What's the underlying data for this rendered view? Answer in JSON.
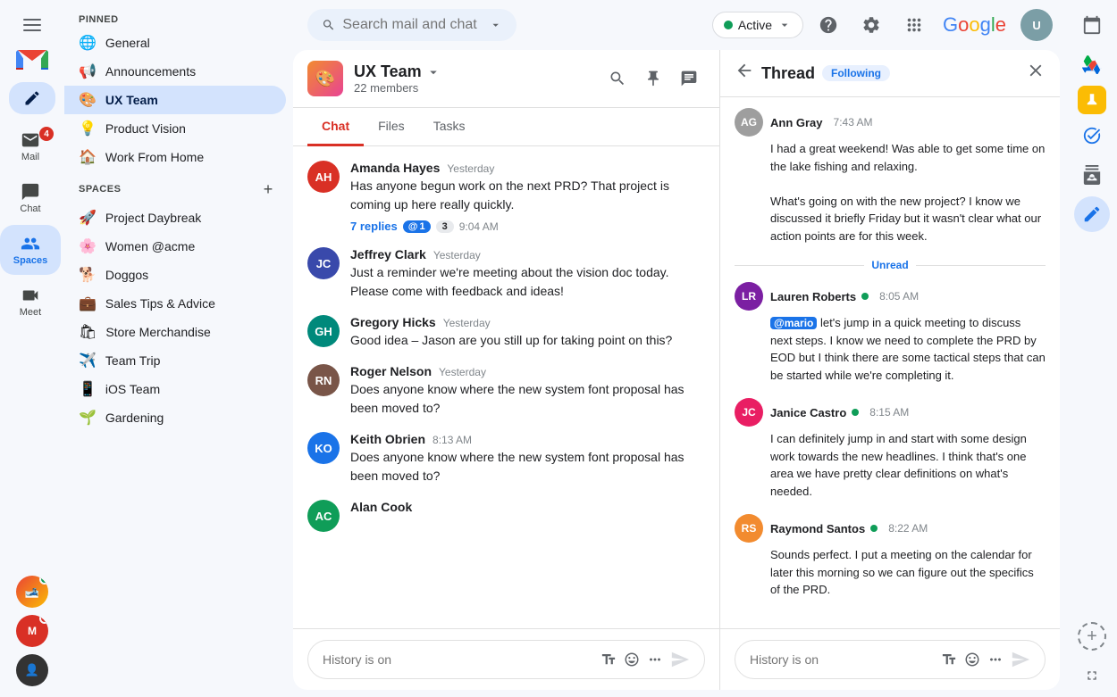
{
  "app": {
    "title": "Gmail",
    "search_placeholder": "Search mail and chat"
  },
  "status": {
    "label": "Active",
    "dropdown_icon": "▾"
  },
  "nav": {
    "compose_icon": "✏",
    "mail_label": "Mail",
    "mail_badge": "4",
    "chat_label": "Chat",
    "spaces_label": "Spaces",
    "meet_label": "Meet"
  },
  "sidebar": {
    "pinned_label": "PINNED",
    "spaces_label": "SPACES",
    "pinned_items": [
      {
        "icon": "🌐",
        "label": "General"
      },
      {
        "icon": "📢",
        "label": "Announcements"
      },
      {
        "icon": "🎨",
        "label": "UX Team",
        "active": true
      },
      {
        "icon": "💡",
        "label": "Product Vision"
      },
      {
        "icon": "🏠",
        "label": "Work From Home"
      }
    ],
    "spaces_items": [
      {
        "icon": "🚀",
        "label": "Project Daybreak"
      },
      {
        "icon": "🌸",
        "label": "Women @acme"
      },
      {
        "icon": "🐕",
        "label": "Doggos"
      },
      {
        "icon": "💼",
        "label": "Sales Tips & Advice"
      },
      {
        "icon": "🛍",
        "label": "Store Merchandise"
      },
      {
        "icon": "✈️",
        "label": "Team Trip"
      },
      {
        "icon": "📱",
        "label": "iOS Team"
      },
      {
        "icon": "🌱",
        "label": "Gardening"
      }
    ]
  },
  "channel": {
    "name": "UX Team",
    "members": "22 members",
    "tabs": [
      "Chat",
      "Files",
      "Tasks"
    ],
    "active_tab": "Chat"
  },
  "messages": [
    {
      "author": "Amanda Hayes",
      "time": "Yesterday",
      "text": "Has anyone begun work on the next PRD? That project is coming up here really quickly.",
      "replies": "7 replies",
      "badge1": "1",
      "badge2": "3",
      "reply_time": "9:04 AM",
      "avatar_color": "av-red",
      "initials": "AH"
    },
    {
      "author": "Jeffrey Clark",
      "time": "Yesterday",
      "text": "Just a reminder we're meeting about the vision doc today. Please come with feedback and ideas!",
      "avatar_color": "av-indigo",
      "initials": "JC"
    },
    {
      "author": "Gregory Hicks",
      "time": "Yesterday",
      "text": "Good idea – Jason are you still up for taking point on this?",
      "avatar_color": "av-teal",
      "initials": "GH"
    },
    {
      "author": "Roger Nelson",
      "time": "Yesterday",
      "text": "Does anyone know where the new system font proposal has been moved to?",
      "avatar_color": "av-brown",
      "initials": "RN"
    },
    {
      "author": "Keith Obrien",
      "time": "8:13 AM",
      "text": "Does anyone know where the new system font proposal has been moved to?",
      "avatar_color": "av-blue",
      "initials": "KO"
    },
    {
      "author": "Alan Cook",
      "time": "",
      "text": "",
      "avatar_color": "av-green",
      "initials": "AC"
    }
  ],
  "chat_input": {
    "placeholder": "History is on"
  },
  "thread": {
    "title": "Thread",
    "following": "Following",
    "messages": [
      {
        "author": "Ann Gray",
        "time": "7:43 AM",
        "text": "I had a great weekend! Was able to get some time on the lake fishing and relaxing.\n\nWhat's going on with the new project? I know we discussed it briefly Friday but it wasn't clear what our action points are for this week.",
        "avatar_color": "av-gray",
        "initials": "AG",
        "online": false
      },
      {
        "author": "Lauren Roberts",
        "time": "8:05 AM",
        "text": "@mario let's jump in a quick meeting to discuss next steps. I know we need to complete the PRD by EOD but I think there are some tactical steps that can be started while we're completing it.",
        "mention": "@mario",
        "avatar_color": "av-purple",
        "initials": "LR",
        "online": true
      },
      {
        "author": "Janice Castro",
        "time": "8:15 AM",
        "text": "I can definitely jump in and start with some design work towards the new headlines. I think that's one area we have pretty clear definitions on what's needed.",
        "avatar_color": "av-pink",
        "initials": "JC",
        "online": true
      },
      {
        "author": "Raymond Santos",
        "time": "8:22 AM",
        "text": "Sounds perfect. I put a meeting on the calendar for later this morning so we can figure out the specifics of the PRD.",
        "avatar_color": "av-orange",
        "initials": "RS",
        "online": true
      }
    ],
    "unread_label": "Unread"
  },
  "thread_input": {
    "placeholder": "History is on"
  }
}
